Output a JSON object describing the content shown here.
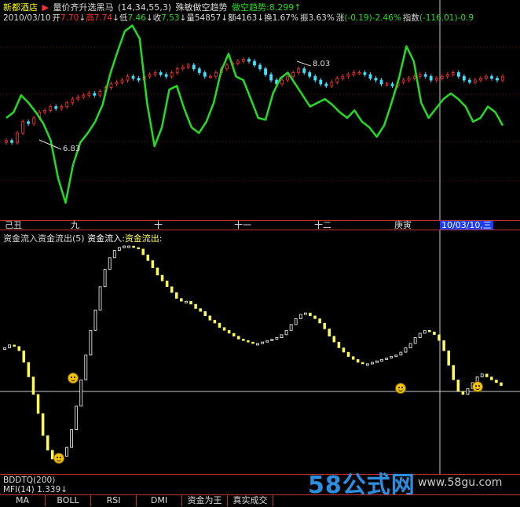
{
  "header1": {
    "stock_name": "新都酒店",
    "indicator": "量价齐升选黑马",
    "params": "(14,34,55,3)",
    "mode": "殊敏做空趋势",
    "trend_label": "做空趋势:",
    "trend_value": "8.299",
    "trend_arrow": "↑"
  },
  "header2": {
    "date": "2010/03/10",
    "open_label": "开",
    "open": "7.70",
    "open_arrow": "↓",
    "high_label": "高",
    "high": "7.74",
    "high_arrow": "↓",
    "low_label": "低",
    "low": "7.46",
    "low_arrow": "↓",
    "close_label": "收",
    "close": "7.53",
    "close_arrow": "↓",
    "vol_label": "量",
    "vol": "54857",
    "vol_arrow": "↓",
    "amt_label": "额",
    "amt": "4163",
    "amt_arrow": "↓",
    "turn_label": "换",
    "turn": "1.67%",
    "amp_label": "振",
    "amp": "3.63%",
    "chg_label": "涨",
    "chg": "(-0.19)-2.46%",
    "idx_label": "指数",
    "idx": "(-116.01)-0.9"
  },
  "annotations": {
    "high_mark": "8.03",
    "low_mark": "6.83"
  },
  "axis": {
    "labels": [
      "己丑",
      "九",
      "十",
      "十一",
      "十二",
      "庚寅",
      "10/03/10,三"
    ]
  },
  "mid_header": {
    "name": "资金流入资金流出(5)",
    "in_label": "资金流入:",
    "out_label": "资金流出:"
  },
  "bottom_info": {
    "line1": "BDDTQ(200)",
    "line2": "MFI(14) 1.339",
    "line2_arrow": "↓"
  },
  "tabs": [
    "MA",
    "BOLL",
    "RSI",
    "DMI",
    "资金为王",
    "真实成交"
  ],
  "watermark": {
    "big": "58公式网",
    "small": "www.58gu.com"
  },
  "colors": {
    "up": "#ff3030",
    "down": "#40e0ff",
    "green_line": "#22dd22",
    "yellow": "#ffff55",
    "header_green": "#22dd22",
    "header_yellow": "#ffff00"
  },
  "chart_data": [
    {
      "type": "line",
      "series": [
        {
          "values": [
            38,
            37,
            42,
            48,
            47,
            50,
            53,
            54,
            56,
            55,
            56,
            58,
            60,
            61,
            62,
            63,
            62,
            64,
            66,
            68,
            69,
            70,
            72,
            71,
            70,
            72,
            73,
            74,
            73,
            72,
            74,
            76,
            77,
            78,
            76,
            74,
            72,
            72,
            74,
            76,
            78,
            79,
            80,
            81,
            80,
            78,
            76,
            73,
            70,
            68,
            70,
            72,
            74,
            76,
            74,
            72,
            70,
            68,
            67,
            69,
            71,
            72,
            73,
            74,
            74,
            73,
            71,
            70,
            68,
            68,
            67,
            69,
            70,
            71,
            72,
            73,
            72,
            70,
            71,
            72,
            73,
            74,
            72,
            70,
            69,
            70,
            71,
            72,
            71,
            70,
            72
          ]
        },
        {
          "values": [
            50,
            53,
            62,
            58,
            53,
            47,
            38,
            18,
            5,
            25,
            37,
            42,
            48,
            57,
            73,
            85,
            96,
            99,
            92,
            58,
            35,
            45,
            65,
            67,
            55,
            45,
            42,
            48,
            58,
            75,
            84,
            72,
            70,
            60,
            50,
            49,
            63,
            71,
            74,
            68,
            62,
            56,
            58,
            60,
            57,
            53,
            50,
            54,
            48,
            45,
            40,
            46,
            58,
            71,
            88,
            80,
            58,
            50,
            55,
            60,
            63,
            60,
            56,
            48,
            50,
            56,
            53,
            46
          ]
        }
      ]
    },
    {
      "type": "bar",
      "series": [
        {
          "values": [
            30,
            32,
            31,
            28,
            20,
            10,
            -2,
            -15,
            -30,
            -40,
            -46,
            -46,
            -44,
            -38,
            -26,
            -10,
            8,
            25,
            42,
            56,
            72,
            84,
            92,
            97,
            99,
            100,
            100,
            99,
            98,
            94,
            90,
            85,
            80,
            76,
            72,
            68,
            64,
            62,
            62,
            60,
            57,
            55,
            52,
            49,
            47,
            44,
            42,
            40,
            38,
            36,
            35,
            34,
            33,
            33,
            34,
            35,
            36,
            37,
            39,
            42,
            46,
            50,
            53,
            54,
            52,
            50,
            47,
            43,
            38,
            34,
            30,
            27,
            24,
            22,
            20,
            19,
            19,
            20,
            21,
            22,
            23,
            24,
            25,
            27,
            30,
            33,
            37,
            40,
            42,
            41,
            39,
            35,
            28,
            18,
            8,
            0,
            -2,
            2,
            6,
            10,
            12,
            10,
            8,
            6,
            4
          ]
        }
      ]
    }
  ]
}
